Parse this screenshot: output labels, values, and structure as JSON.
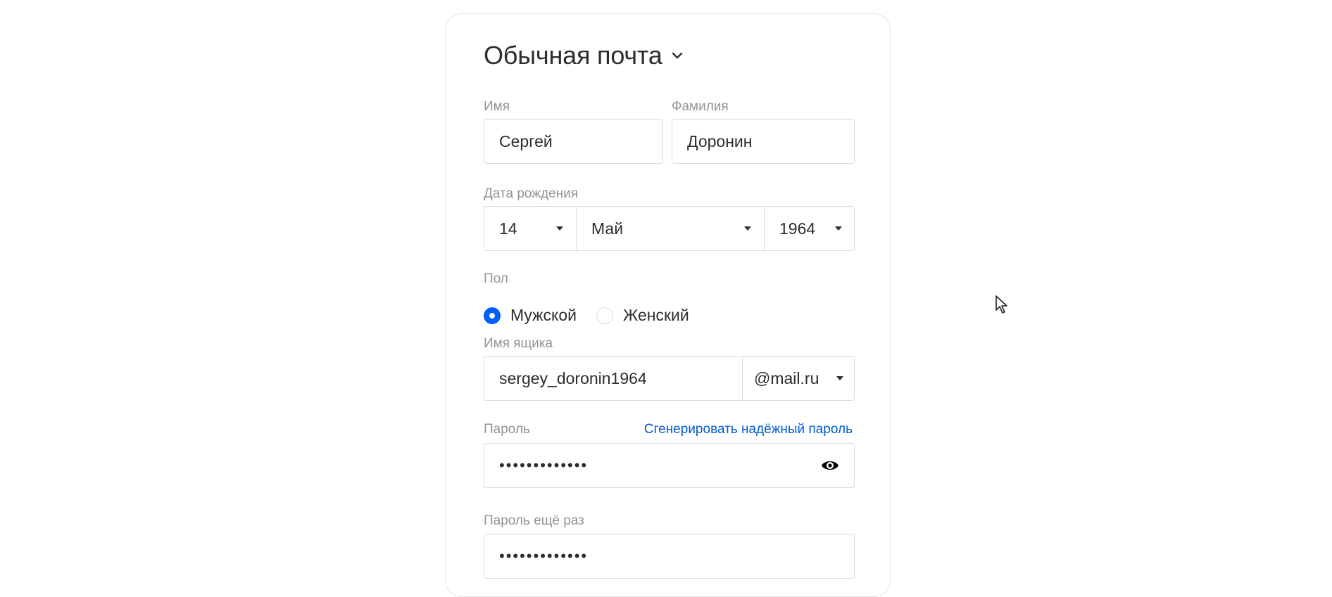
{
  "form": {
    "title": "Обычная почта",
    "first_name": {
      "label": "Имя",
      "value": "Сергей"
    },
    "last_name": {
      "label": "Фамилия",
      "value": "Доронин"
    },
    "birth_date": {
      "label": "Дата рождения",
      "day": "14",
      "month": "Май",
      "year": "1964"
    },
    "gender": {
      "label": "Пол",
      "options": [
        "Мужской",
        "Женский"
      ],
      "selected": "Мужской"
    },
    "mailbox": {
      "label": "Имя ящика",
      "value": "sergey_doronin1964",
      "domain": "@mail.ru"
    },
    "password": {
      "label": "Пароль",
      "generate_link": "Сгенерировать надёжный пароль",
      "value": "•••••••••••••"
    },
    "password_repeat": {
      "label": "Пароль ещё раз",
      "value": "•••••••••••••"
    }
  },
  "icons": [
    "chevron-down-icon",
    "caret-down-icon",
    "eye-icon",
    "mouse-cursor-icon"
  ],
  "colors": {
    "accent": "#005ff9",
    "link": "#005bd1",
    "label": "#919399",
    "border": "#dadbdd"
  }
}
